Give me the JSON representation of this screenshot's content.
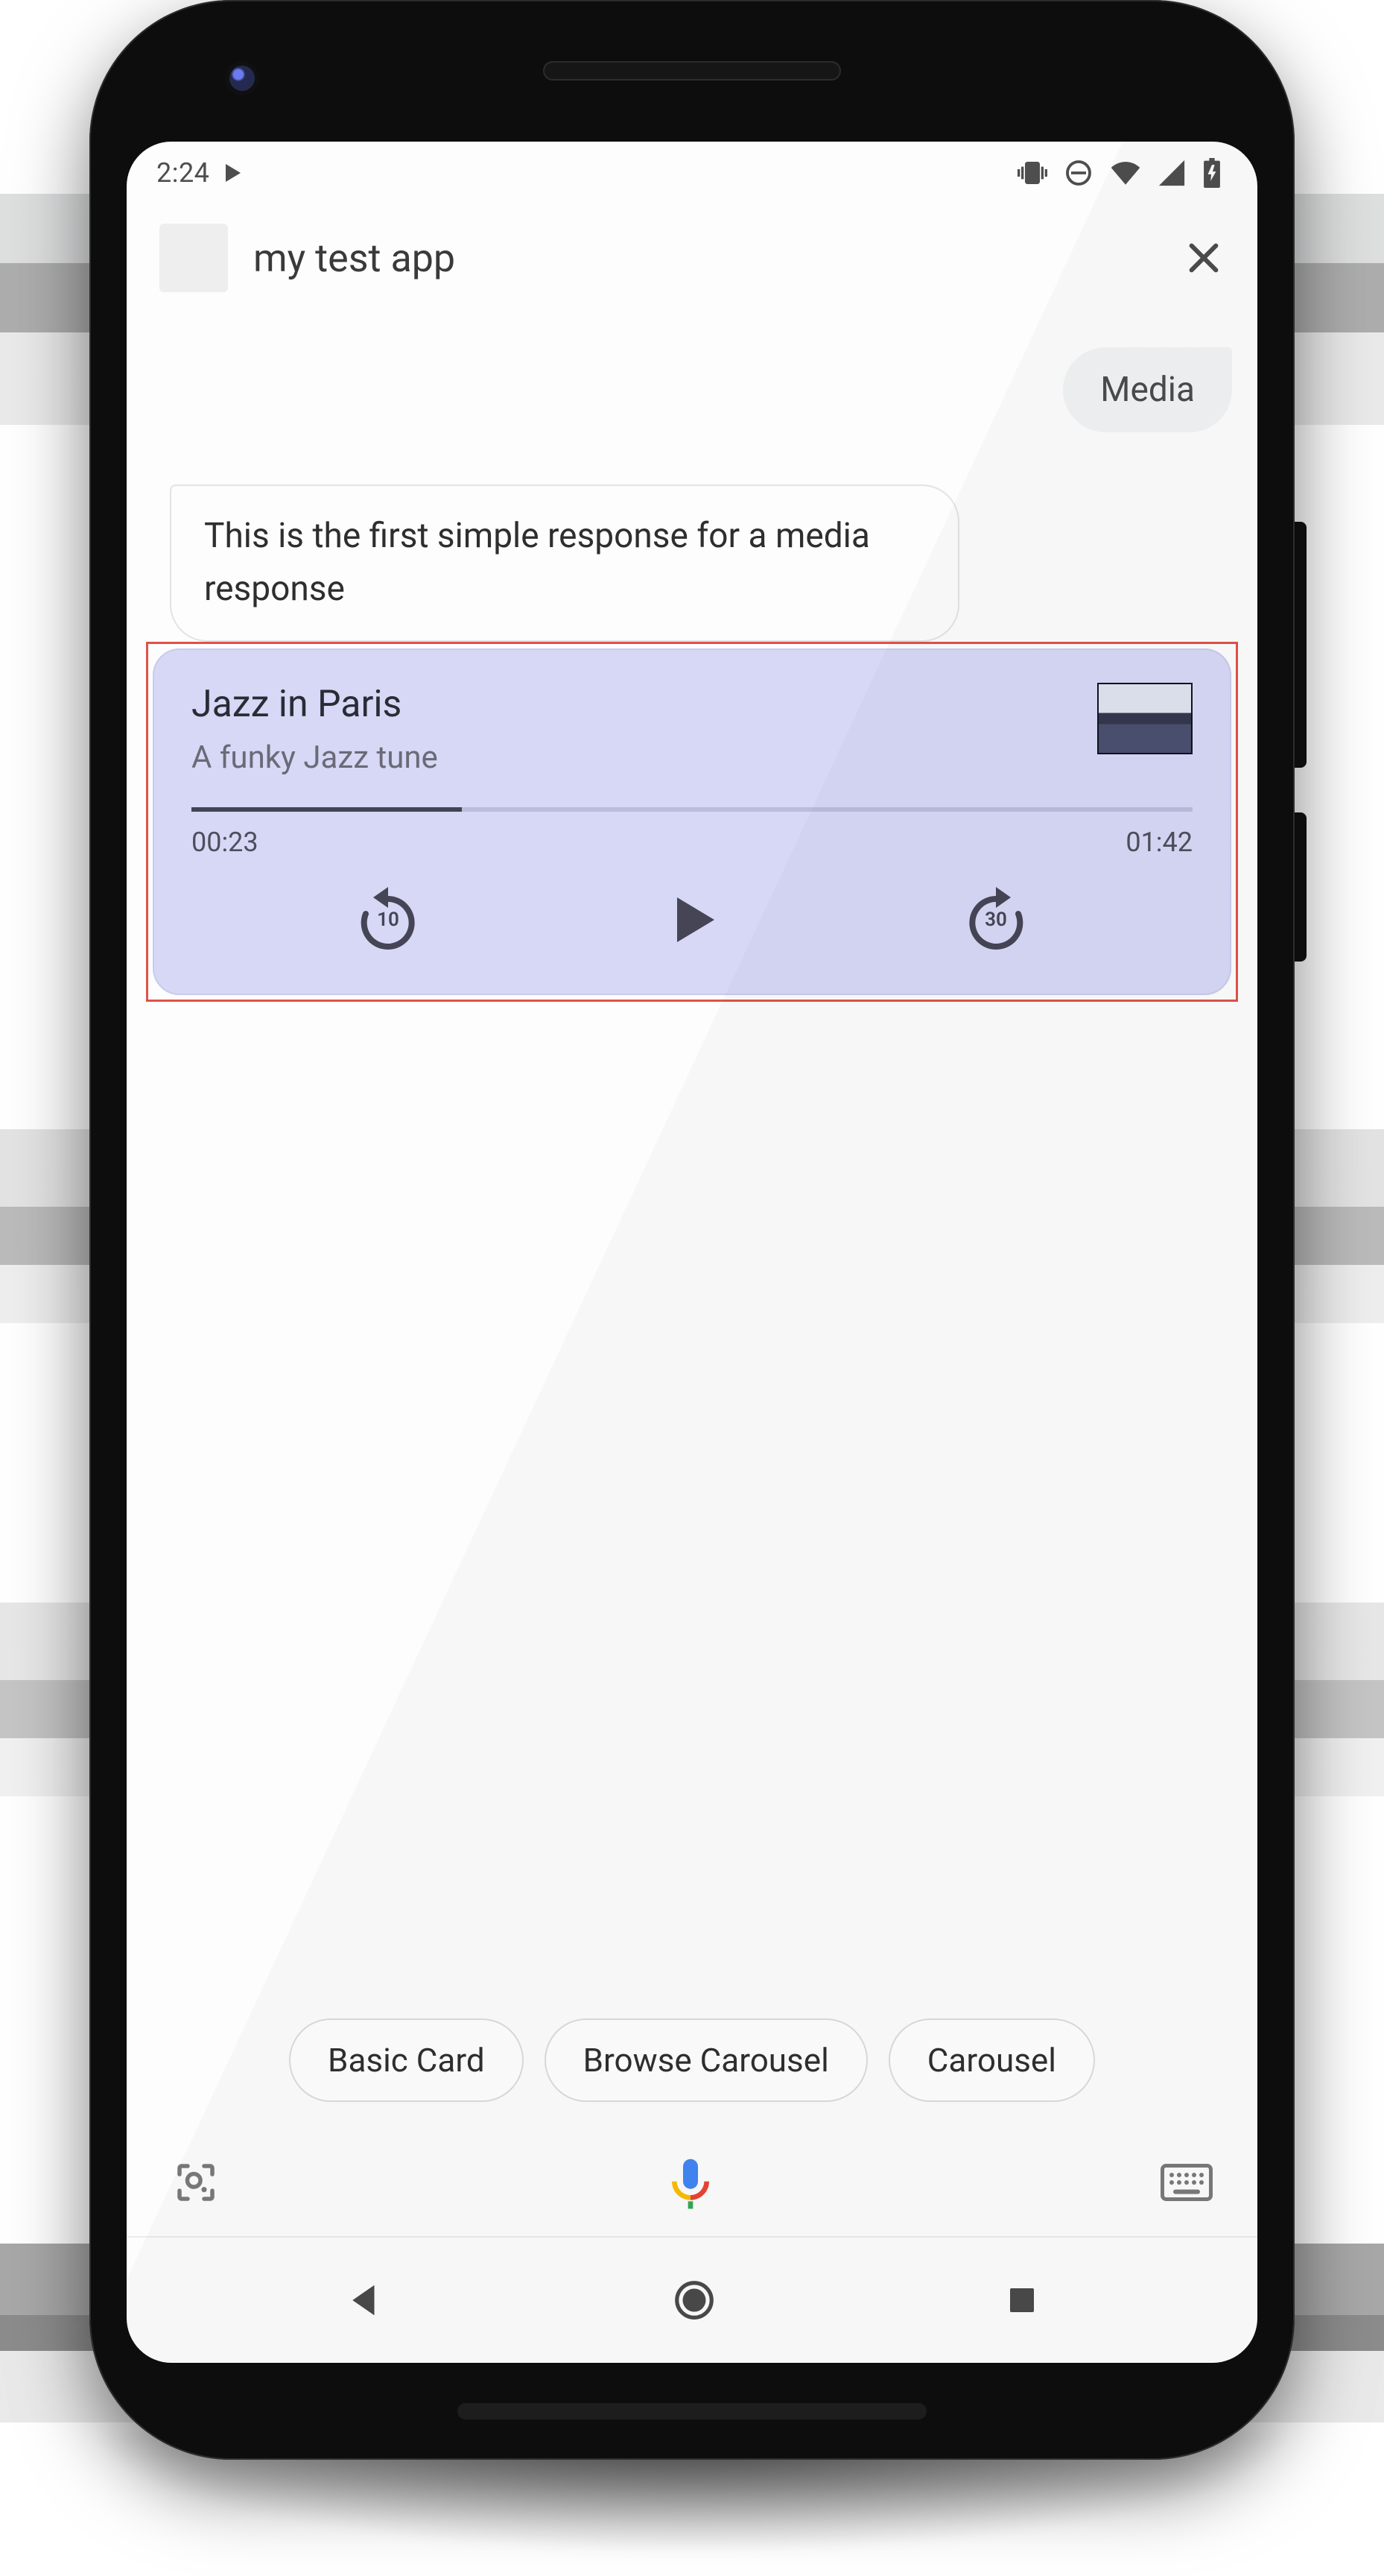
{
  "status": {
    "time": "2:24"
  },
  "header": {
    "app_name": "my test app"
  },
  "chat": {
    "user_msg": "Media",
    "bot_msg": "This is the first simple response for a media response"
  },
  "media": {
    "title": "Jazz in Paris",
    "subtitle": "A funky Jazz tune",
    "elapsed": "00:23",
    "total": "01:42",
    "progress_pct": "27%",
    "rewind_sec": "10",
    "forward_sec": "30"
  },
  "chips": {
    "a": "Basic Card",
    "b": "Browse Carousel",
    "c": "Carousel"
  }
}
